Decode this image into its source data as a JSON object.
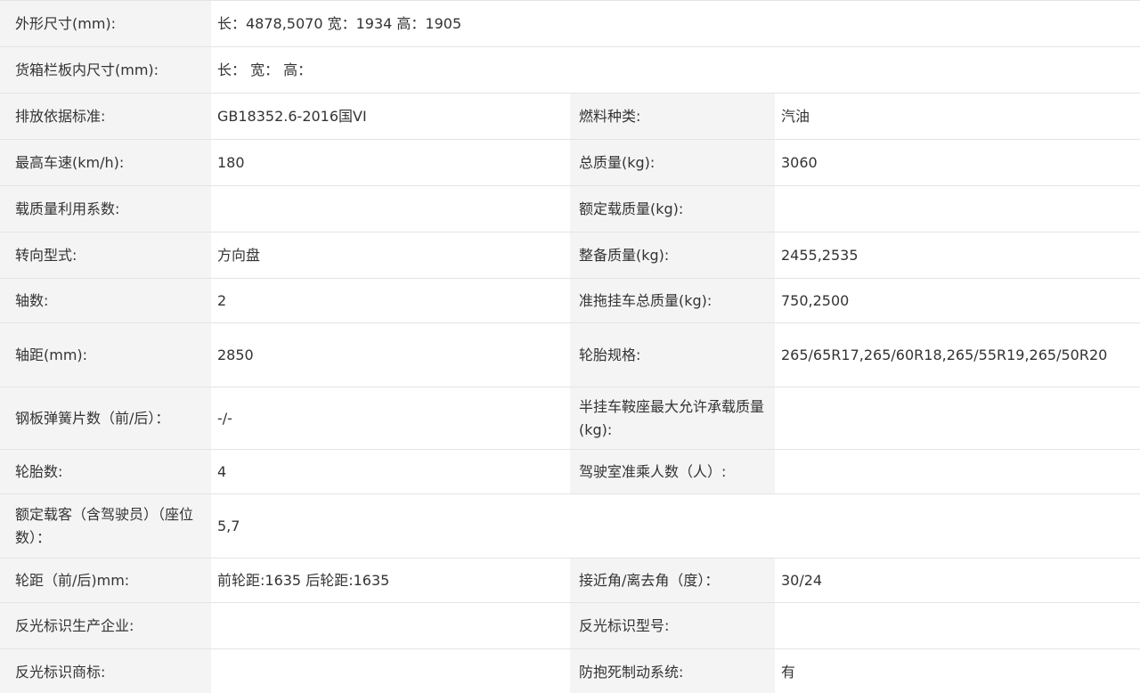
{
  "rows": [
    {
      "l1": "外形尺寸(mm):",
      "v1": "长：4878,5070 宽：1934 高：1905"
    },
    {
      "l1": "货箱栏板内尺寸(mm):",
      "v1": "长： 宽： 高："
    },
    {
      "l1": "排放依据标准:",
      "v1": "GB18352.6-2016国VI",
      "l2": "燃料种类:",
      "v2": "汽油"
    },
    {
      "l1": "最高车速(km/h):",
      "v1": "180",
      "l2": "总质量(kg):",
      "v2": "3060"
    },
    {
      "l1": "载质量利用系数:",
      "v1": "",
      "l2": "额定载质量(kg):",
      "v2": ""
    },
    {
      "l1": "转向型式:",
      "v1": "方向盘",
      "l2": "整备质量(kg):",
      "v2": "2455,2535"
    },
    {
      "l1": "轴数:",
      "v1": "2",
      "l2": "准拖挂车总质量(kg):",
      "v2": "750,2500"
    },
    {
      "l1": "轴距(mm):",
      "v1": "2850",
      "l2": "轮胎规格:",
      "v2": "265/65R17,265/60R18,265/55R19,265/50R20"
    },
    {
      "l1": "钢板弹簧片数（前/后）：",
      "v1": "-/-",
      "l2": "半挂车鞍座最大允许承载质量(kg):",
      "v2": ""
    },
    {
      "l1": "轮胎数:",
      "v1": "4",
      "l2": "驾驶室准乘人数（人）:",
      "v2": ""
    },
    {
      "l1": "额定载客（含驾驶员）（座位数）：",
      "v1": "5,7"
    },
    {
      "l1": "轮距（前/后)mm:",
      "v1": "前轮距:1635 后轮距:1635",
      "l2": "接近角/离去角（度）：",
      "v2": "30/24"
    },
    {
      "l1": "反光标识生产企业:",
      "v1": "",
      "l2": "反光标识型号:",
      "v2": ""
    },
    {
      "l1": "反光标识商标:",
      "v1": "",
      "l2": "防抱死制动系统:",
      "v2": "有"
    }
  ]
}
